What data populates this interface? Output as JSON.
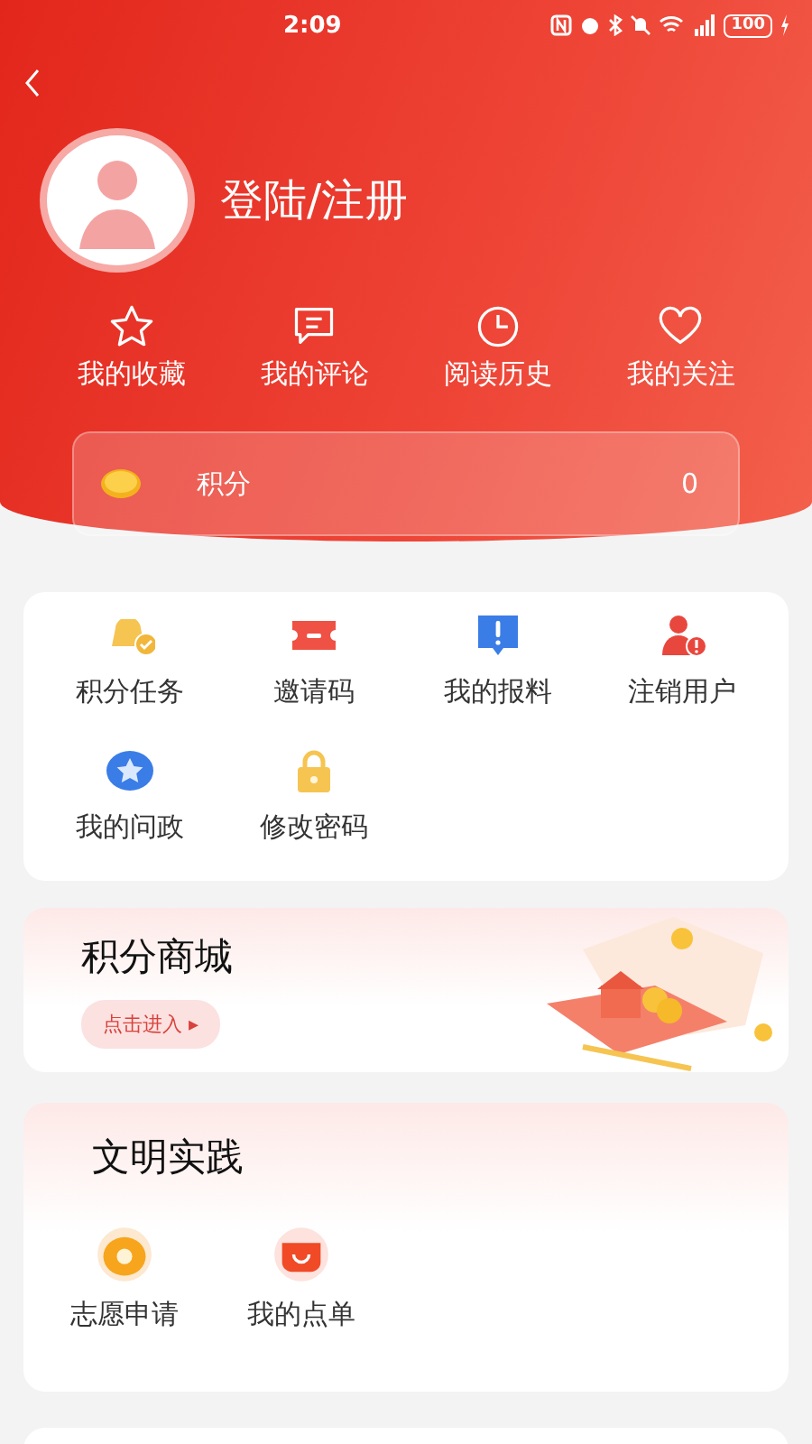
{
  "status_bar": {
    "time": "2:09",
    "battery": "100"
  },
  "profile": {
    "login_label": "登陆/注册"
  },
  "shortcuts": [
    {
      "label": "我的收藏"
    },
    {
      "label": "我的评论"
    },
    {
      "label": "阅读历史"
    },
    {
      "label": "我的关注"
    }
  ],
  "points": {
    "label": "积分",
    "value": "0"
  },
  "services": [
    {
      "label": "积分任务"
    },
    {
      "label": "邀请码"
    },
    {
      "label": "我的报料"
    },
    {
      "label": "注销用户"
    },
    {
      "label": "我的问政"
    },
    {
      "label": "修改密码"
    }
  ],
  "mall": {
    "title": "积分商城",
    "button": "点击进入 ▸"
  },
  "practice": {
    "title": "文明实践",
    "items": [
      {
        "label": "志愿申请"
      },
      {
        "label": "我的点单"
      }
    ]
  }
}
